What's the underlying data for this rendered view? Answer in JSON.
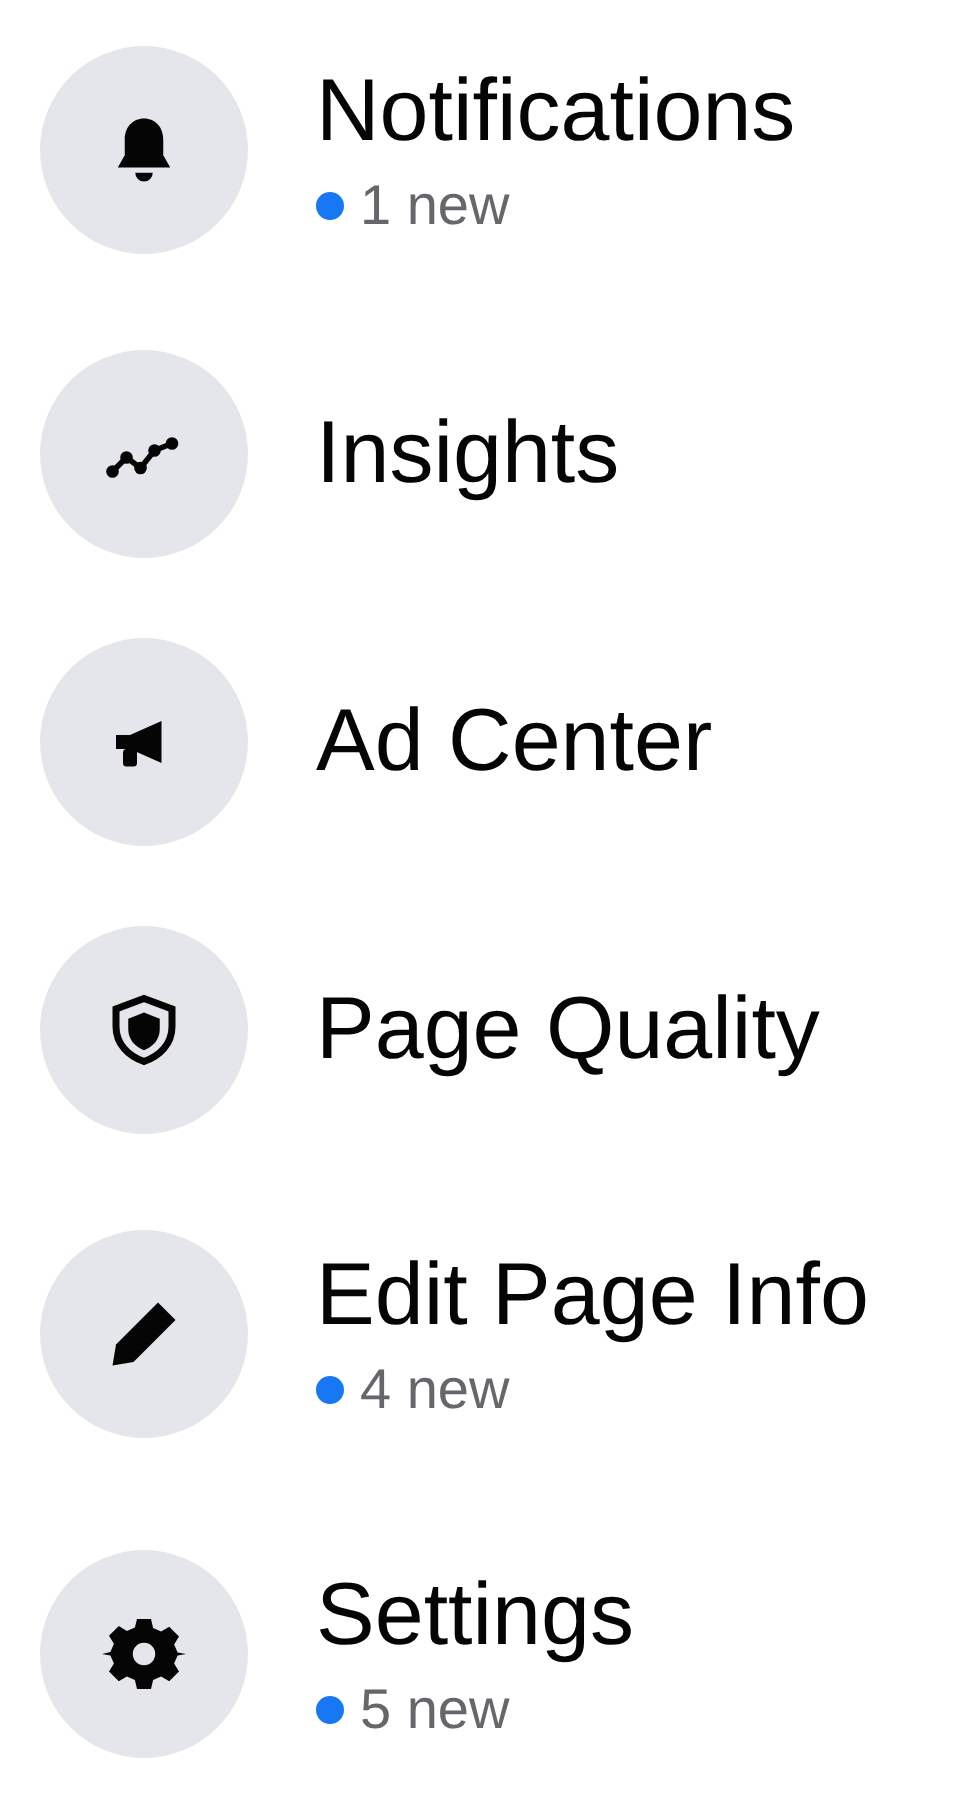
{
  "menu": {
    "items": [
      {
        "label": "Notifications",
        "badge": "1 new"
      },
      {
        "label": "Insights"
      },
      {
        "label": "Ad Center"
      },
      {
        "label": "Page Quality"
      },
      {
        "label": "Edit Page Info",
        "badge": "4 new"
      },
      {
        "label": "Settings",
        "badge": "5 new"
      }
    ]
  }
}
